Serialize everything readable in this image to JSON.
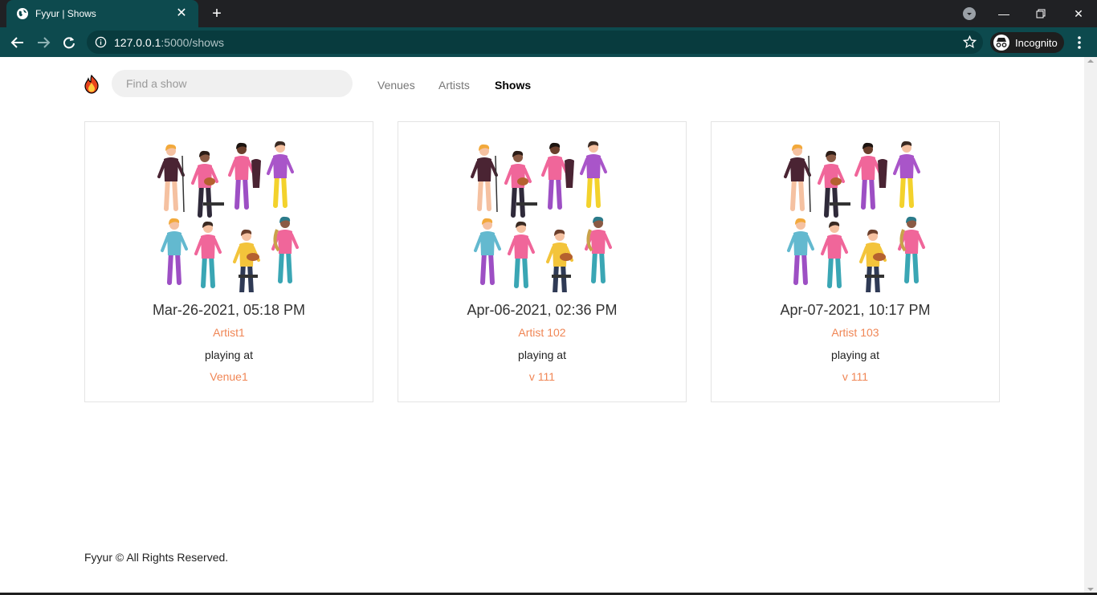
{
  "browser": {
    "tab_title": "Fyyur | Shows",
    "url_host": "127.0.0.1",
    "url_rest": ":5000/shows",
    "profile_label": "Incognito",
    "tab_close_glyph": "✕",
    "new_tab_glyph": "+",
    "minimize_glyph": "—",
    "close_glyph": "✕"
  },
  "navbar": {
    "search_placeholder": "Find a show",
    "links": [
      "Venues",
      "Artists",
      "Shows"
    ],
    "active_link": "Shows"
  },
  "shows": [
    {
      "date": "Mar-26-2021, 05:18 PM",
      "artist": "Artist1",
      "playing": "playing at",
      "venue": "Venue1"
    },
    {
      "date": "Apr-06-2021, 02:36 PM",
      "artist": "Artist 102",
      "playing": "playing at",
      "venue": "v 111"
    },
    {
      "date": "Apr-07-2021, 10:17 PM",
      "artist": "Artist 103",
      "playing": "playing at",
      "venue": "v 111"
    }
  ],
  "footer": {
    "text": "Fyyur © All Rights Reserved."
  },
  "colors": {
    "tab_teal": "#0d4a4e",
    "link_orange": "#f08655"
  }
}
